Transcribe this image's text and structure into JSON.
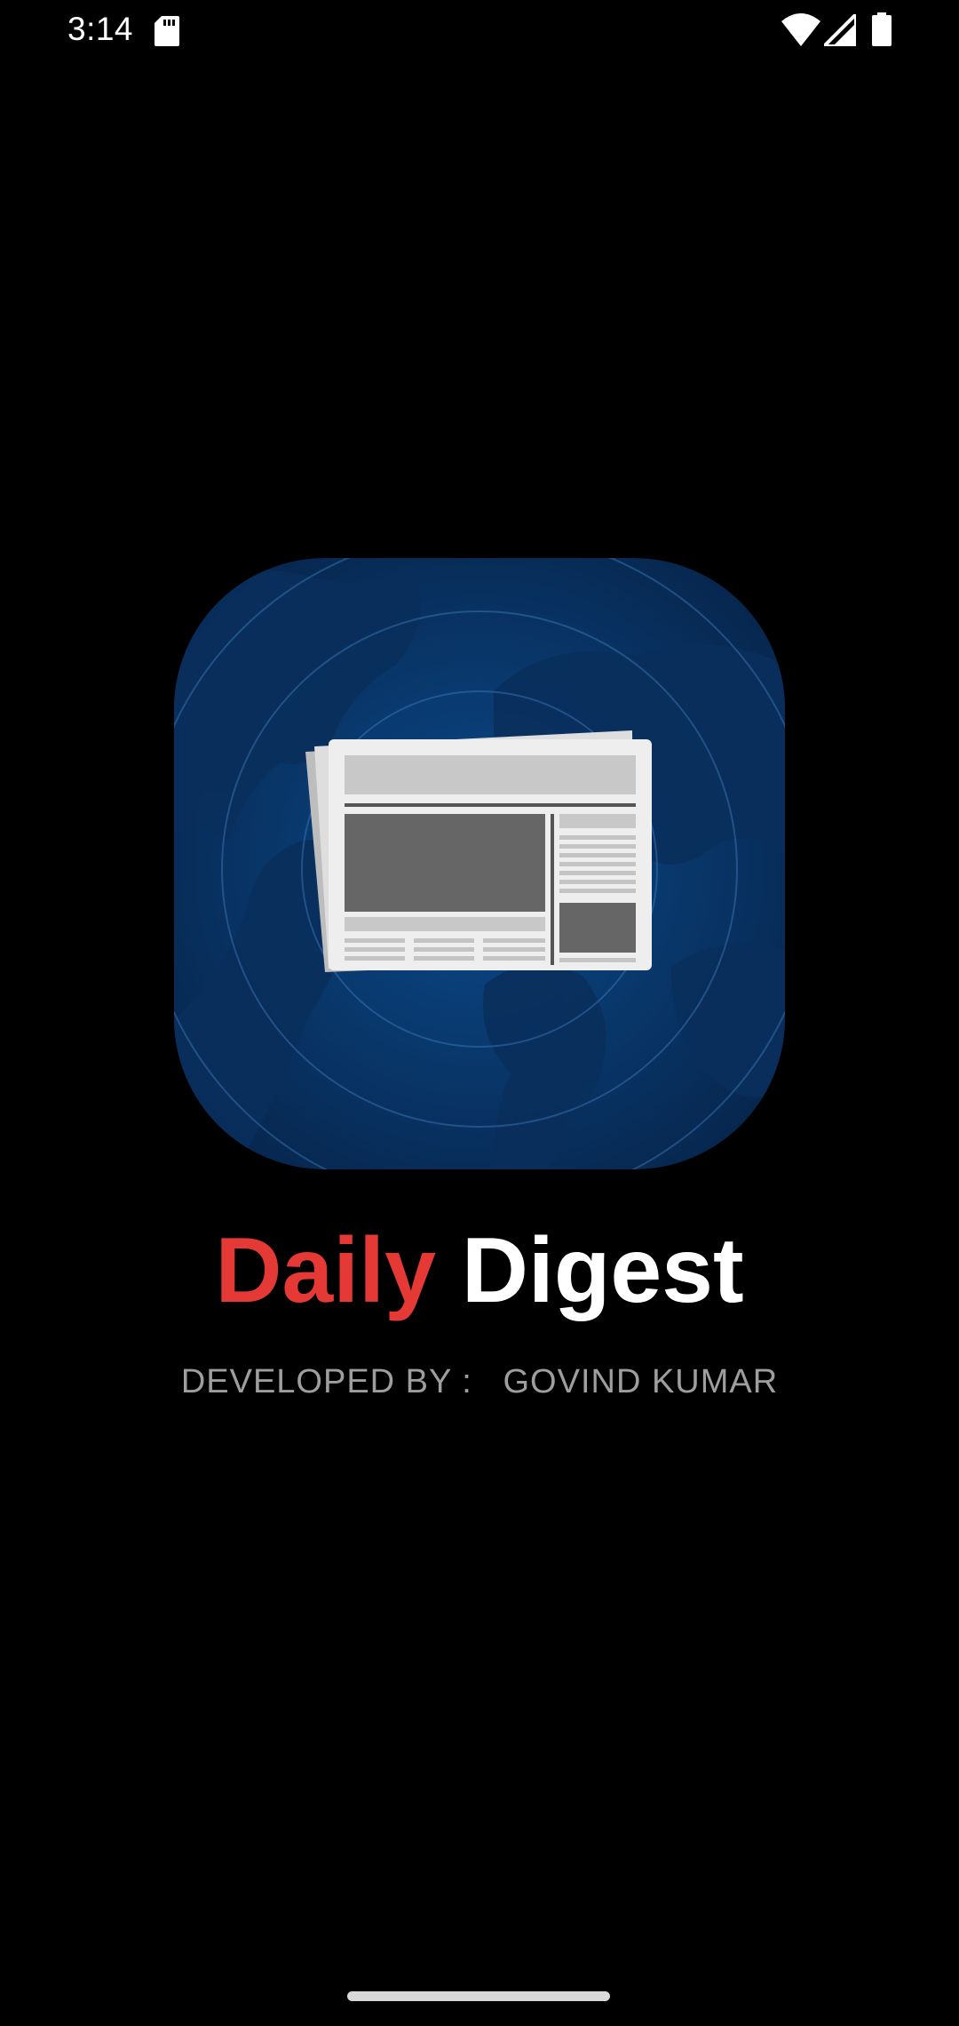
{
  "status_bar": {
    "time": "3:14",
    "icons": [
      "sd-card-icon",
      "wifi-icon",
      "cell-signal-icon",
      "battery-icon"
    ]
  },
  "splash": {
    "logo_icon": "globe-newspaper-icon",
    "title_part1": "Daily",
    "title_part2": "Digest",
    "developer_label": "DEVELOPED BY :",
    "developer_name": "GOVIND KUMAR"
  },
  "colors": {
    "background": "#000000",
    "title_accent": "#e53935",
    "title_main": "#ffffff",
    "subtitle": "#9e9e9e",
    "logo_blue": "#0a3a6e"
  }
}
